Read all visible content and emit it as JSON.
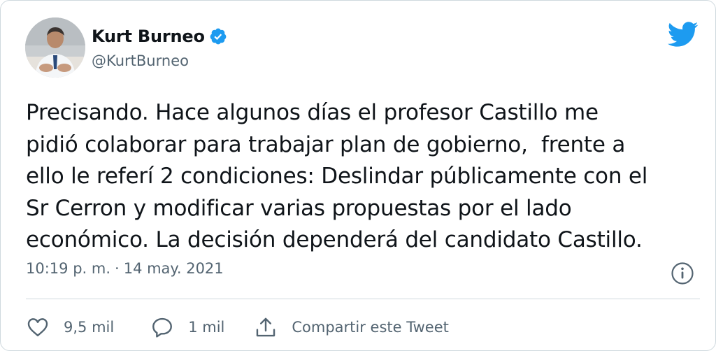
{
  "author": {
    "name": "Kurt Burneo",
    "handle": "@KurtBurneo",
    "verified": true
  },
  "tweet": {
    "text": "Precisando. Hace algunos días el profesor Castillo me\npidió colaborar para trabajar plan de gobierno,  frente a\nello le referí 2 condiciones: Deslindar públicamente con el\nSr Cerron y modificar varias propuestas por el lado\neconómico. La decisión dependerá del candidato Castillo.",
    "time": "10:19 p. m.",
    "separator": "·",
    "date": "14 may. 2021"
  },
  "actions": {
    "likes": "9,5 mil",
    "replies": "1 mil",
    "share_label": "Compartir este Tweet"
  },
  "colors": {
    "brand": "#1d9bf0",
    "secondary_text": "#536471",
    "border": "#cfd9de"
  },
  "icons": {
    "brand": "twitter-bird-icon",
    "verified": "verified-badge-icon",
    "info": "info-icon",
    "like": "heart-icon",
    "reply": "speech-bubble-icon",
    "share": "share-icon"
  }
}
